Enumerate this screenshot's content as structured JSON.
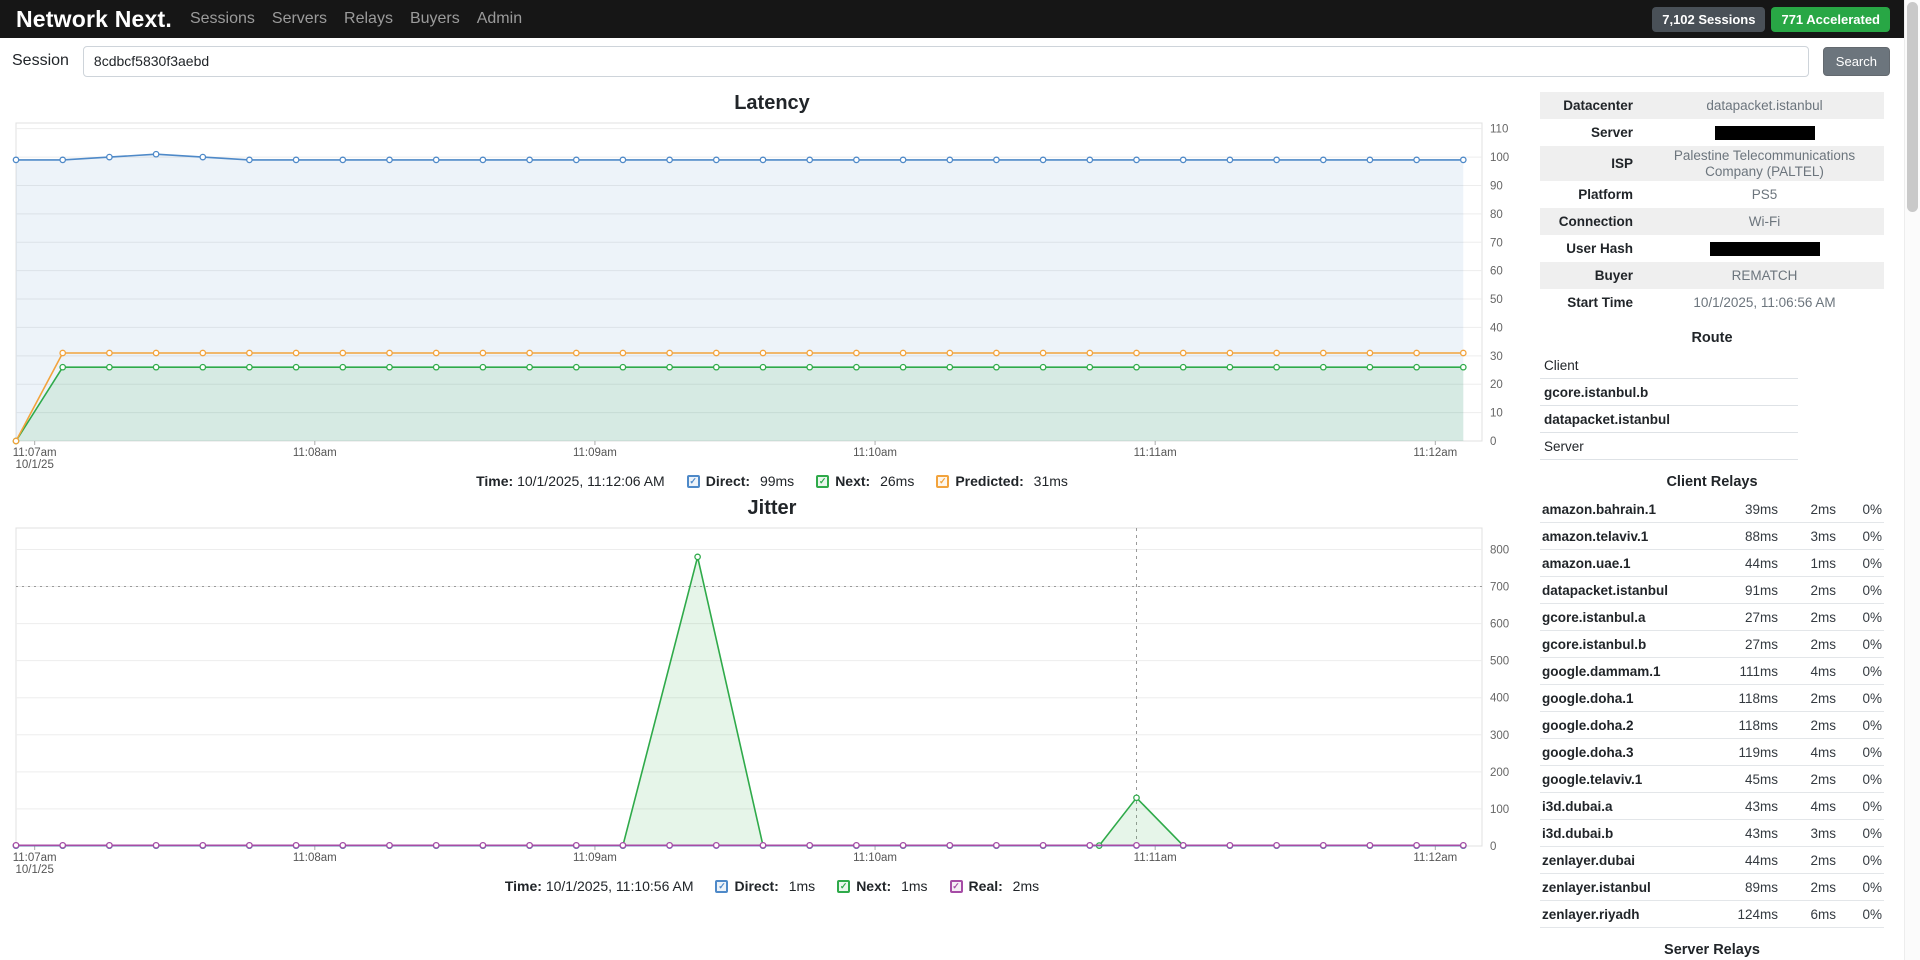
{
  "navbar": {
    "brand": "Network Next.",
    "links": [
      "Sessions",
      "Servers",
      "Relays",
      "Buyers",
      "Admin"
    ],
    "sessions_badge": "7,102 Sessions",
    "accelerated_badge": "771 Accelerated",
    "colors": {
      "sessions_badge_bg": "#495057",
      "accelerated_badge_bg": "#28a745",
      "navbar_bg": "#161616"
    }
  },
  "search": {
    "label": "Session",
    "value": "8cdbcf5830f3aebd",
    "button": "Search"
  },
  "chart_data": [
    {
      "id": "latency",
      "type": "line",
      "title": "Latency",
      "x_range": [
        0,
        314
      ],
      "ylim": [
        0,
        112
      ],
      "y_ticks": [
        0,
        10,
        20,
        30,
        40,
        50,
        60,
        70,
        80,
        90,
        100,
        110
      ],
      "x_ticks": [
        {
          "x": 4,
          "label": "11:07am",
          "sub": "10/1/25"
        },
        {
          "x": 64,
          "label": "11:08am"
        },
        {
          "x": 124,
          "label": "11:09am"
        },
        {
          "x": 184,
          "label": "11:10am"
        },
        {
          "x": 244,
          "label": "11:11am"
        },
        {
          "x": 304,
          "label": "11:12am"
        }
      ],
      "series": [
        {
          "name": "Direct",
          "color": "#4e89c8",
          "fill": "rgba(78,137,200,0.10)",
          "x": [
            0,
            10,
            20,
            30,
            40,
            50,
            60,
            70,
            80,
            90,
            100,
            110,
            120,
            130,
            140,
            150,
            160,
            170,
            180,
            190,
            200,
            210,
            220,
            230,
            240,
            250,
            260,
            270,
            280,
            290,
            300,
            310
          ],
          "y": [
            99,
            99,
            100,
            101,
            100,
            99,
            99,
            99,
            99,
            99,
            99,
            99,
            99,
            99,
            99,
            99,
            99,
            99,
            99,
            99,
            99,
            99,
            99,
            99,
            99,
            99,
            99,
            99,
            99,
            99,
            99,
            99
          ]
        },
        {
          "name": "Next",
          "color": "#2faa4a",
          "fill": "rgba(47,170,74,0.12)",
          "x": [
            0,
            10,
            20,
            30,
            40,
            50,
            60,
            70,
            80,
            90,
            100,
            110,
            120,
            130,
            140,
            150,
            160,
            170,
            180,
            190,
            200,
            210,
            220,
            230,
            240,
            250,
            260,
            270,
            280,
            290,
            300,
            310
          ],
          "y": [
            0,
            26,
            26,
            26,
            26,
            26,
            26,
            26,
            26,
            26,
            26,
            26,
            26,
            26,
            26,
            26,
            26,
            26,
            26,
            26,
            26,
            26,
            26,
            26,
            26,
            26,
            26,
            26,
            26,
            26,
            26,
            26
          ]
        },
        {
          "name": "Predicted",
          "color": "#f2a33c",
          "fill": null,
          "x": [
            0,
            10,
            20,
            30,
            40,
            50,
            60,
            70,
            80,
            90,
            100,
            110,
            120,
            130,
            140,
            150,
            160,
            170,
            180,
            190,
            200,
            210,
            220,
            230,
            240,
            250,
            260,
            270,
            280,
            290,
            300,
            310
          ],
          "y": [
            0,
            31,
            31,
            31,
            31,
            31,
            31,
            31,
            31,
            31,
            31,
            31,
            31,
            31,
            31,
            31,
            31,
            31,
            31,
            31,
            31,
            31,
            31,
            31,
            31,
            31,
            31,
            31,
            31,
            31,
            31,
            31
          ]
        }
      ],
      "legend": {
        "time_label": "Time:",
        "time": "10/1/2025, 11:12:06 AM",
        "entries": [
          {
            "label": "Direct:",
            "value": "99ms",
            "color": "#4e89c8"
          },
          {
            "label": "Next:",
            "value": "26ms",
            "color": "#2faa4a"
          },
          {
            "label": "Predicted:",
            "value": "31ms",
            "color": "#f2a33c"
          }
        ]
      }
    },
    {
      "id": "jitter",
      "type": "line",
      "title": "Jitter",
      "x_range": [
        0,
        314
      ],
      "ylim": [
        0,
        858
      ],
      "y_ticks": [
        0,
        100,
        200,
        300,
        400,
        500,
        600,
        700,
        800
      ],
      "ref_line": 700,
      "cursor_x": 240,
      "x_ticks": [
        {
          "x": 4,
          "label": "11:07am",
          "sub": "10/1/25"
        },
        {
          "x": 64,
          "label": "11:08am"
        },
        {
          "x": 124,
          "label": "11:09am"
        },
        {
          "x": 184,
          "label": "11:10am"
        },
        {
          "x": 244,
          "label": "11:11am"
        },
        {
          "x": 304,
          "label": "11:12am"
        }
      ],
      "series": [
        {
          "name": "Next",
          "color": "#2faa4a",
          "fill": "rgba(47,170,74,0.12)",
          "x": [
            0,
            10,
            20,
            30,
            40,
            50,
            60,
            70,
            80,
            90,
            100,
            110,
            120,
            130,
            146,
            160,
            170,
            180,
            190,
            200,
            210,
            220,
            232,
            240,
            250,
            260,
            270,
            280,
            290,
            300,
            310
          ],
          "y": [
            1,
            1,
            1,
            1,
            1,
            1,
            1,
            1,
            1,
            1,
            1,
            1,
            1,
            1,
            780,
            1,
            1,
            1,
            1,
            1,
            1,
            1,
            1,
            130,
            1,
            1,
            1,
            1,
            1,
            1,
            1
          ]
        },
        {
          "name": "Direct",
          "color": "#4e89c8",
          "fill": null,
          "x": [
            0,
            10,
            20,
            30,
            40,
            50,
            60,
            70,
            80,
            90,
            100,
            110,
            120,
            130,
            140,
            150,
            160,
            170,
            180,
            190,
            200,
            210,
            220,
            230,
            240,
            250,
            260,
            270,
            280,
            290,
            300,
            310
          ],
          "y": [
            1,
            1,
            1,
            1,
            1,
            1,
            1,
            1,
            1,
            1,
            1,
            1,
            1,
            1,
            1,
            1,
            1,
            1,
            1,
            1,
            1,
            1,
            1,
            1,
            1,
            1,
            1,
            1,
            1,
            1,
            1,
            1
          ]
        },
        {
          "name": "Real",
          "color": "#a64ca6",
          "fill": null,
          "x": [
            0,
            10,
            20,
            30,
            40,
            50,
            60,
            70,
            80,
            90,
            100,
            110,
            120,
            130,
            140,
            150,
            160,
            170,
            180,
            190,
            200,
            210,
            220,
            230,
            240,
            250,
            260,
            270,
            280,
            290,
            300,
            310
          ],
          "y": [
            2,
            2,
            2,
            2,
            2,
            2,
            2,
            2,
            2,
            2,
            2,
            2,
            2,
            2,
            2,
            2,
            2,
            2,
            2,
            2,
            2,
            2,
            2,
            2,
            2,
            2,
            2,
            2,
            2,
            2,
            2,
            2
          ]
        }
      ],
      "legend": {
        "time_label": "Time:",
        "time": "10/1/2025, 11:10:56 AM",
        "entries": [
          {
            "label": "Direct:",
            "value": "1ms",
            "color": "#4e89c8"
          },
          {
            "label": "Next:",
            "value": "1ms",
            "color": "#2faa4a"
          },
          {
            "label": "Real:",
            "value": "2ms",
            "color": "#a64ca6"
          }
        ]
      }
    }
  ],
  "session_info": [
    {
      "label": "Datacenter",
      "value": "datapacket.istanbul"
    },
    {
      "label": "Server",
      "redacted": true,
      "redacted_width": 100
    },
    {
      "label": "ISP",
      "value": "Palestine Telecommunications Company (PALTEL)"
    },
    {
      "label": "Platform",
      "value": "PS5"
    },
    {
      "label": "Connection",
      "value": "Wi-Fi"
    },
    {
      "label": "User Hash",
      "redacted": true,
      "redacted_width": 110
    },
    {
      "label": "Buyer",
      "value": "REMATCH"
    },
    {
      "label": "Start Time",
      "value": "10/1/2025, 11:06:56 AM"
    }
  ],
  "route": {
    "title": "Route",
    "items": [
      {
        "name": "Client",
        "bold": false
      },
      {
        "name": "gcore.istanbul.b",
        "bold": true
      },
      {
        "name": "datapacket.istanbul",
        "bold": true
      },
      {
        "name": "Server",
        "bold": false
      }
    ]
  },
  "client_relays": {
    "title": "Client Relays",
    "rows": [
      {
        "name": "amazon.bahrain.1",
        "rtt": "39ms",
        "jitter": "2ms",
        "loss": "0%"
      },
      {
        "name": "amazon.telaviv.1",
        "rtt": "88ms",
        "jitter": "3ms",
        "loss": "0%"
      },
      {
        "name": "amazon.uae.1",
        "rtt": "44ms",
        "jitter": "1ms",
        "loss": "0%"
      },
      {
        "name": "datapacket.istanbul",
        "rtt": "91ms",
        "jitter": "2ms",
        "loss": "0%"
      },
      {
        "name": "gcore.istanbul.a",
        "rtt": "27ms",
        "jitter": "2ms",
        "loss": "0%"
      },
      {
        "name": "gcore.istanbul.b",
        "rtt": "27ms",
        "jitter": "2ms",
        "loss": "0%"
      },
      {
        "name": "google.dammam.1",
        "rtt": "111ms",
        "jitter": "4ms",
        "loss": "0%"
      },
      {
        "name": "google.doha.1",
        "rtt": "118ms",
        "jitter": "2ms",
        "loss": "0%"
      },
      {
        "name": "google.doha.2",
        "rtt": "118ms",
        "jitter": "2ms",
        "loss": "0%"
      },
      {
        "name": "google.doha.3",
        "rtt": "119ms",
        "jitter": "4ms",
        "loss": "0%"
      },
      {
        "name": "google.telaviv.1",
        "rtt": "45ms",
        "jitter": "2ms",
        "loss": "0%"
      },
      {
        "name": "i3d.dubai.a",
        "rtt": "43ms",
        "jitter": "4ms",
        "loss": "0%"
      },
      {
        "name": "i3d.dubai.b",
        "rtt": "43ms",
        "jitter": "3ms",
        "loss": "0%"
      },
      {
        "name": "zenlayer.dubai",
        "rtt": "44ms",
        "jitter": "2ms",
        "loss": "0%"
      },
      {
        "name": "zenlayer.istanbul",
        "rtt": "89ms",
        "jitter": "2ms",
        "loss": "0%"
      },
      {
        "name": "zenlayer.riyadh",
        "rtt": "124ms",
        "jitter": "6ms",
        "loss": "0%"
      }
    ]
  },
  "server_relays": {
    "title": "Server Relays"
  }
}
